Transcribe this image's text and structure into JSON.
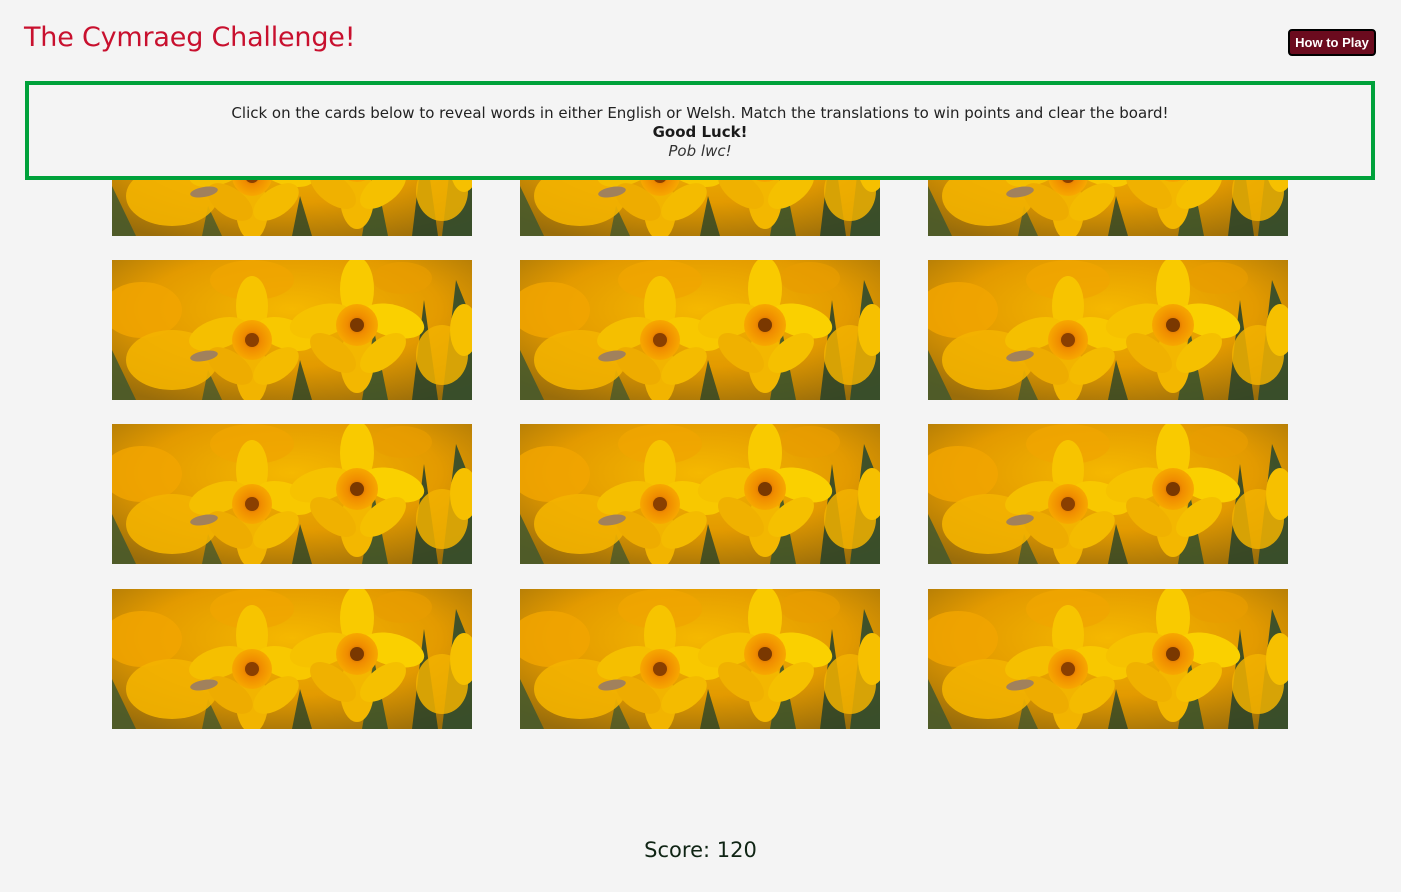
{
  "header": {
    "title": "The Cymraeg Challenge!",
    "how_to_play_label": "How to Play"
  },
  "instructions": {
    "text": "Click on the cards below to reveal words in either English or Welsh. Match the translations to win points and clear the board!",
    "good_luck": "Good Luck!",
    "good_luck_welsh": "Pob lwc!"
  },
  "board": {
    "columns": 3,
    "rows": 4,
    "card_count": 12,
    "card_back_image": "daffodil-photo"
  },
  "score": {
    "label": "Score: 120"
  },
  "colors": {
    "title": "#c8102e",
    "button_bg": "#6b0b1e",
    "instructions_border": "#00a13a",
    "background": "#f4f4f4"
  }
}
